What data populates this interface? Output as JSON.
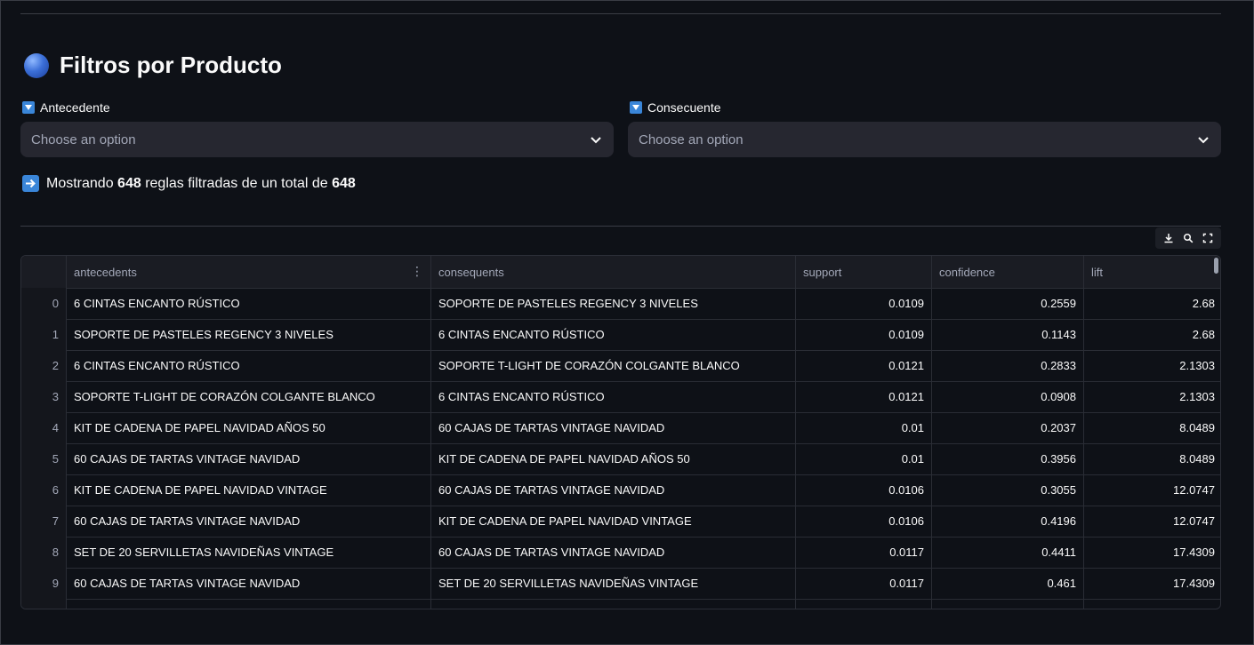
{
  "title": "Filtros por Producto",
  "filters": {
    "antecedent_label": "Antecedente",
    "antecedent_placeholder": "Choose an option",
    "consequent_label": "Consecuente",
    "consequent_placeholder": "Choose an option"
  },
  "summary": {
    "prefix": "Mostrando",
    "shown": "648",
    "middle": "reglas filtradas de un total de",
    "total": "648"
  },
  "table": {
    "columns": [
      "antecedents",
      "consequents",
      "support",
      "confidence",
      "lift"
    ],
    "rows": [
      {
        "idx": "0",
        "antecedents": "6 CINTAS ENCANTO RÚSTICO",
        "consequents": "SOPORTE DE PASTELES REGENCY 3 NIVELES",
        "support": "0.0109",
        "confidence": "0.2559",
        "lift": "2.68"
      },
      {
        "idx": "1",
        "antecedents": "SOPORTE DE PASTELES REGENCY 3 NIVELES",
        "consequents": "6 CINTAS ENCANTO RÚSTICO",
        "support": "0.0109",
        "confidence": "0.1143",
        "lift": "2.68"
      },
      {
        "idx": "2",
        "antecedents": "6 CINTAS ENCANTO RÚSTICO",
        "consequents": "SOPORTE T-LIGHT DE CORAZÓN COLGANTE BLANCO",
        "support": "0.0121",
        "confidence": "0.2833",
        "lift": "2.1303"
      },
      {
        "idx": "3",
        "antecedents": "SOPORTE T-LIGHT DE CORAZÓN COLGANTE BLANCO",
        "consequents": "6 CINTAS ENCANTO RÚSTICO",
        "support": "0.0121",
        "confidence": "0.0908",
        "lift": "2.1303"
      },
      {
        "idx": "4",
        "antecedents": "KIT DE CADENA DE PAPEL NAVIDAD AÑOS 50",
        "consequents": "60 CAJAS DE TARTAS VINTAGE NAVIDAD",
        "support": "0.01",
        "confidence": "0.2037",
        "lift": "8.0489"
      },
      {
        "idx": "5",
        "antecedents": "60 CAJAS DE TARTAS VINTAGE NAVIDAD",
        "consequents": "KIT DE CADENA DE PAPEL NAVIDAD AÑOS 50",
        "support": "0.01",
        "confidence": "0.3956",
        "lift": "8.0489"
      },
      {
        "idx": "6",
        "antecedents": "KIT DE CADENA DE PAPEL NAVIDAD VINTAGE",
        "consequents": "60 CAJAS DE TARTAS VINTAGE NAVIDAD",
        "support": "0.0106",
        "confidence": "0.3055",
        "lift": "12.0747"
      },
      {
        "idx": "7",
        "antecedents": "60 CAJAS DE TARTAS VINTAGE NAVIDAD",
        "consequents": "KIT DE CADENA DE PAPEL NAVIDAD VINTAGE",
        "support": "0.0106",
        "confidence": "0.4196",
        "lift": "12.0747"
      },
      {
        "idx": "8",
        "antecedents": "SET DE 20 SERVILLETAS NAVIDEÑAS VINTAGE",
        "consequents": "60 CAJAS DE TARTAS VINTAGE NAVIDAD",
        "support": "0.0117",
        "confidence": "0.4411",
        "lift": "17.4309"
      },
      {
        "idx": "9",
        "antecedents": "60 CAJAS DE TARTAS VINTAGE NAVIDAD",
        "consequents": "SET DE 20 SERVILLETAS NAVIDEÑAS VINTAGE",
        "support": "0.0117",
        "confidence": "0.461",
        "lift": "17.4309"
      }
    ]
  },
  "colors": {
    "background": "#0e1117",
    "input_bg": "#262730",
    "accent_blue": "#3a86d9"
  }
}
